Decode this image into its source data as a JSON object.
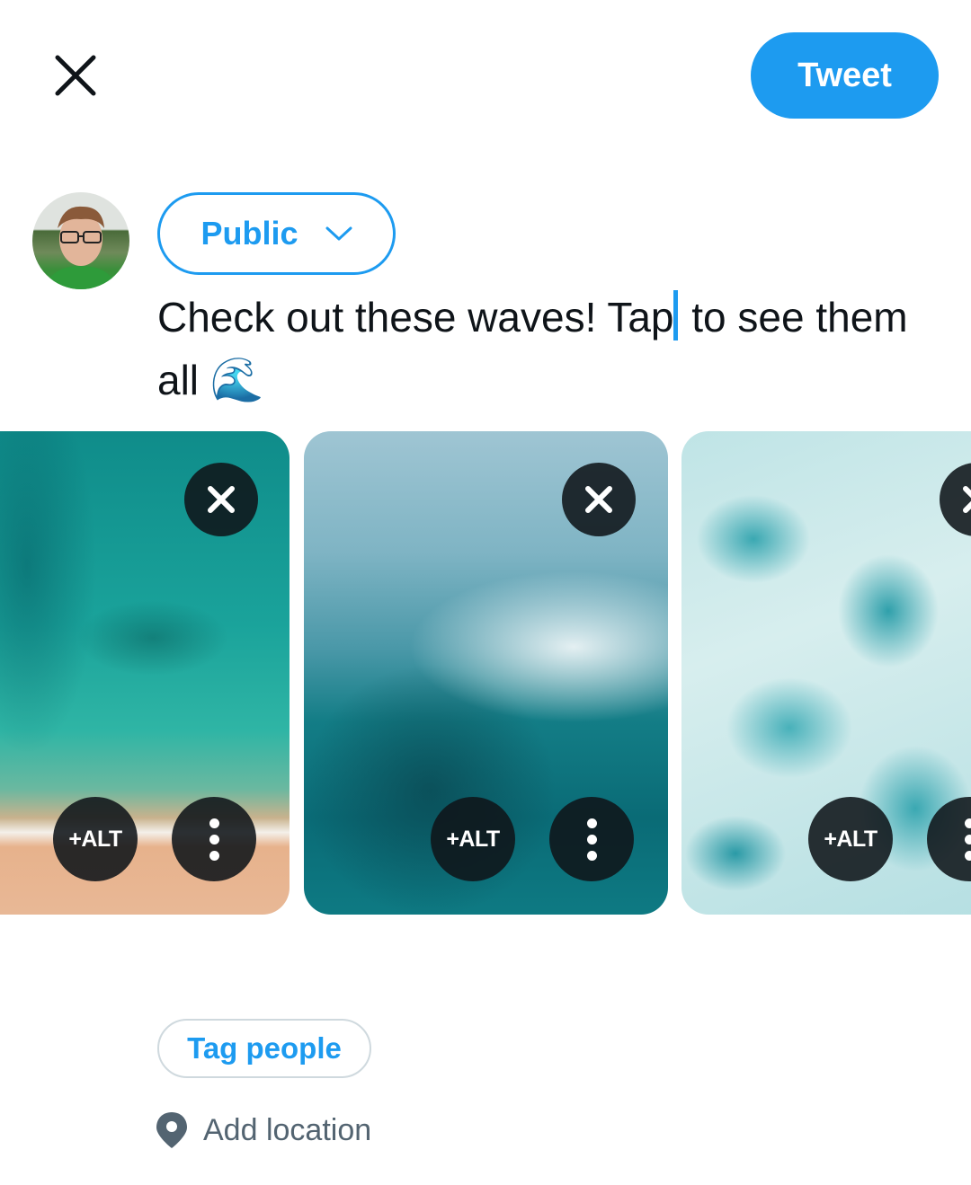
{
  "header": {
    "close_icon": "close-icon",
    "tweet_label": "Tweet"
  },
  "composer": {
    "avatar_alt": "User avatar",
    "audience": {
      "selected": "Public",
      "icon": "chevron-down-icon"
    },
    "text_before_caret": "Check out these waves! Tap",
    "text_after_caret": " to see them all ",
    "emoji": "🌊"
  },
  "media": [
    {
      "name": "Aerial beach with turquoise water",
      "alt_label": "+ALT",
      "remove_icon": "close-icon",
      "more_icon": "more-vertical-icon"
    },
    {
      "name": "Aerial breaking wave",
      "alt_label": "+ALT",
      "remove_icon": "close-icon",
      "more_icon": "more-vertical-icon"
    },
    {
      "name": "Aerial sea foam",
      "alt_label": "+ALT",
      "remove_icon": "close-icon",
      "more_icon": "more-vertical-icon"
    }
  ],
  "actions": {
    "tag_people_label": "Tag people",
    "add_location_label": "Add location",
    "location_icon": "location-pin-icon"
  },
  "colors": {
    "accent": "#1d9bf0",
    "text": "#0f1419",
    "secondary_text": "#536471",
    "border": "#cfd9de"
  }
}
